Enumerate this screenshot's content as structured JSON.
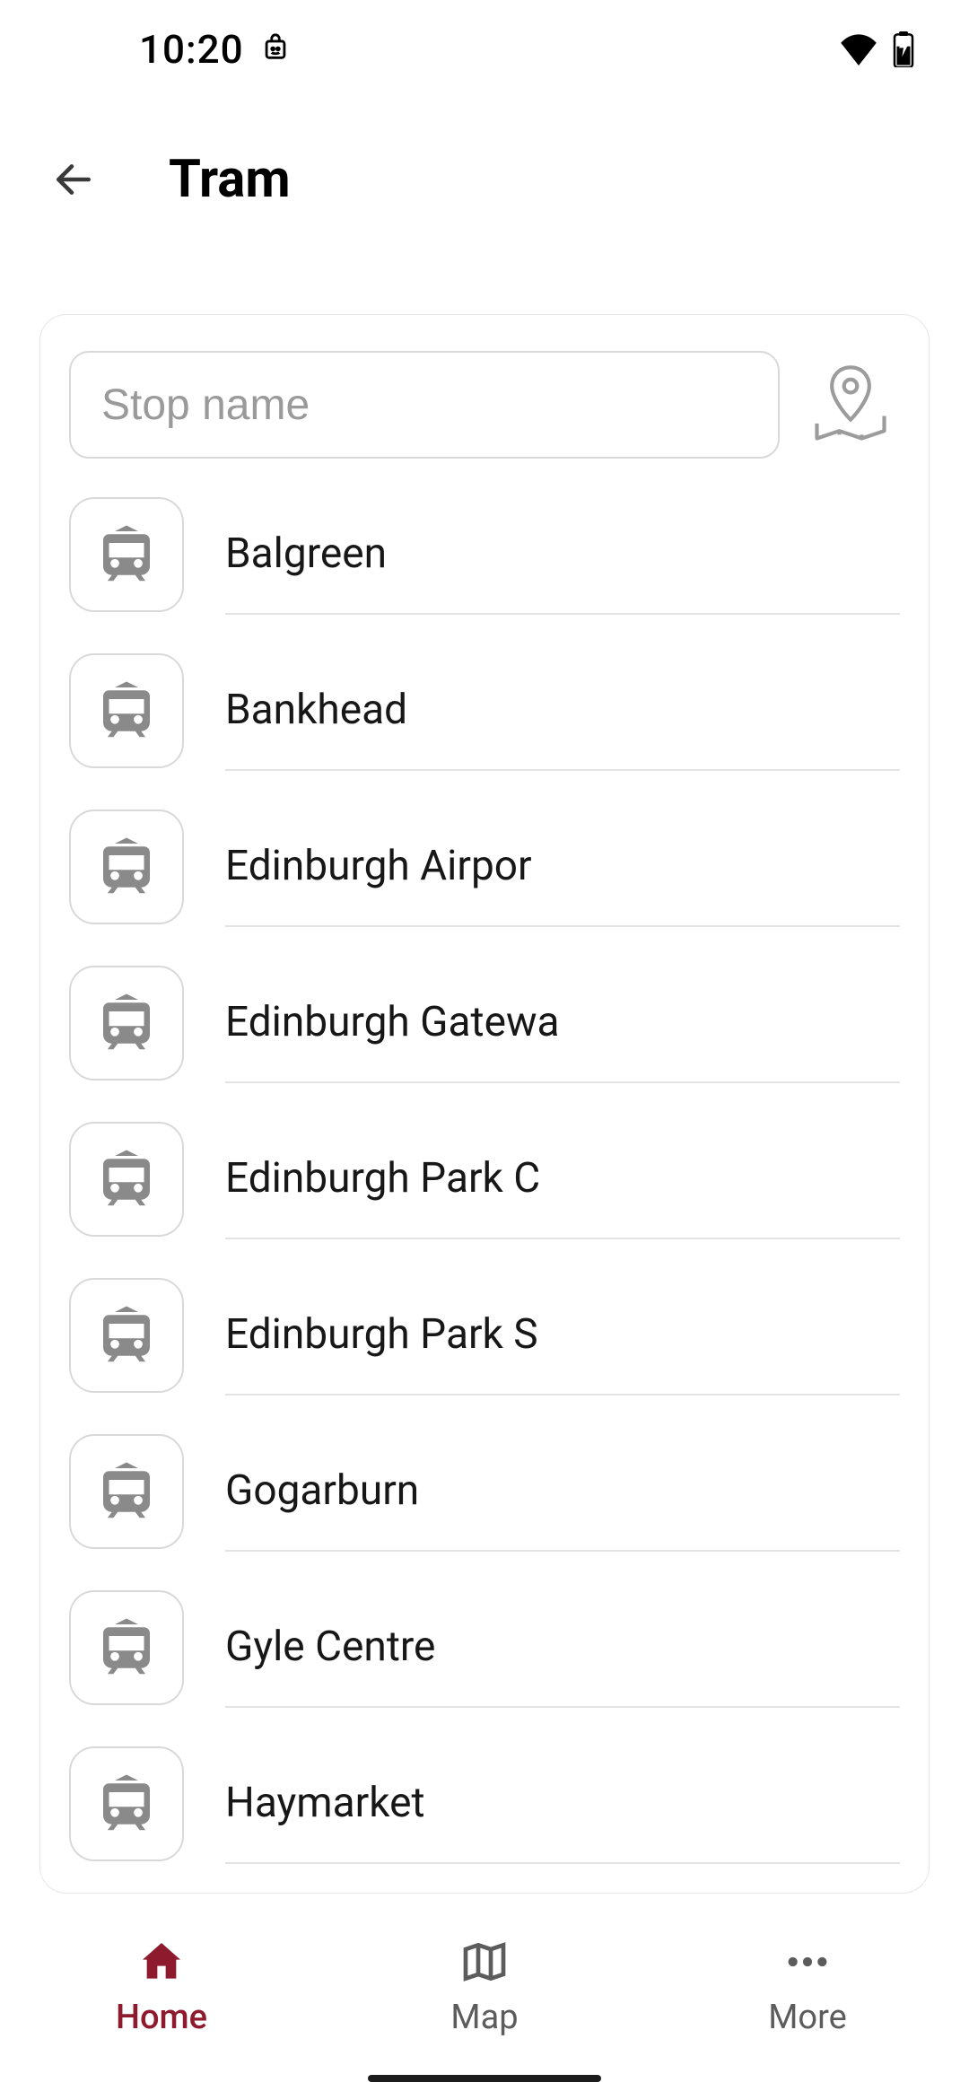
{
  "status": {
    "time": "10:20"
  },
  "header": {
    "title": "Tram"
  },
  "search": {
    "placeholder": "Stop name",
    "value": ""
  },
  "stops": {
    "items": [
      {
        "name": "Balgreen"
      },
      {
        "name": "Bankhead"
      },
      {
        "name": "Edinburgh Airpor"
      },
      {
        "name": "Edinburgh Gatewa"
      },
      {
        "name": "Edinburgh Park C"
      },
      {
        "name": "Edinburgh Park S"
      },
      {
        "name": "Gogarburn"
      },
      {
        "name": "Gyle Centre"
      },
      {
        "name": "Haymarket"
      }
    ]
  },
  "nav": {
    "home": "Home",
    "map": "Map",
    "more": "More"
  },
  "colors": {
    "accent": "#8e1a2e",
    "icon_gray": "#8a8a8a"
  }
}
